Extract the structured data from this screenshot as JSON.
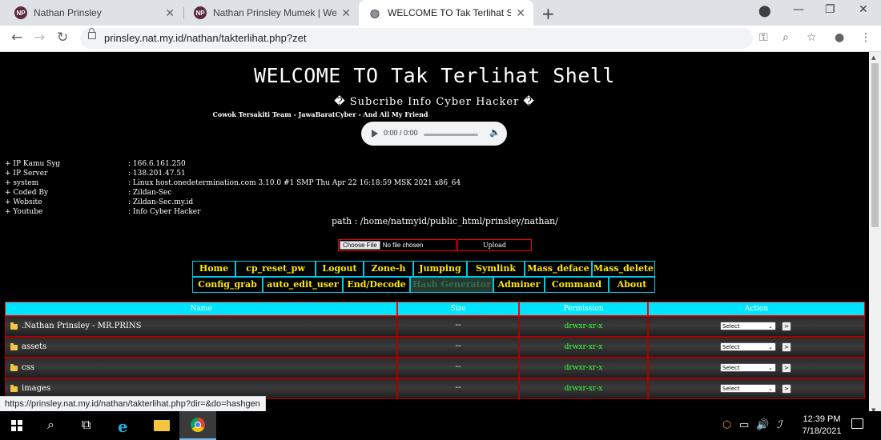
{
  "browser": {
    "tabs": [
      {
        "title": "Nathan Prinsley",
        "favicon": "NP",
        "active": false
      },
      {
        "title": "Nathan Prinsley Mumek | Website",
        "favicon": "NP",
        "active": false
      },
      {
        "title": "WELCOME TO Tak Terlihat Shell",
        "favicon": "globe",
        "active": true
      }
    ],
    "url": "prinsley.nat.my.id/nathan/takterlihat.php?zet",
    "status_url": "https://prinsley.nat.my.id/nathan/takterlihat.php?dir=&do=hashgen"
  },
  "page": {
    "title": "WELCOME TO Tak Terlihat Shell",
    "subtitle": "� Subcribe Info Cyber Hacker �",
    "credits": "Cowok Tersakiti Team - JawaBaratCyber - And All My Friend",
    "audio_time": "0:00 / 0:00",
    "info": [
      {
        "key": "+ IP Kamu Syg",
        "value": ": 166.6.161.250"
      },
      {
        "key": "+ IP Server",
        "value": ": 138.201.47.51"
      },
      {
        "key": "+ system",
        "value": ": Linux host.onedetermination.com 3.10.0 #1 SMP Thu Apr 22 16:18:59 MSK 2021 x86_64"
      },
      {
        "key": "+ Coded By",
        "value": ": Zildan-Sec"
      },
      {
        "key": "+ Website",
        "value": ": Zildan-Sec.my.id"
      },
      {
        "key": "+ Youtube",
        "value": ": Info Cyber Hacker"
      }
    ],
    "path": "path : /home/natmyid/public_html/prinsley/nathan/",
    "upload": {
      "choose_label": "Choose File",
      "no_file": "No file chosen",
      "button": "Upload"
    },
    "menu_row1": [
      "Home",
      "cp_reset_pw",
      "Logout",
      "Zone-h",
      "Jumping",
      "Symlink",
      "Mass_deface",
      "Mass_delete"
    ],
    "menu_row2": [
      "Config_grab",
      "auto_edit_user",
      "End/Decode",
      "Hash Generator",
      "Adminer",
      "Command",
      "About"
    ],
    "table": {
      "headers": [
        "Name",
        "Size",
        "Permission",
        "Action"
      ],
      "rows": [
        {
          "name": ".Nathan Prinsley - MR.PRINS",
          "size": "--",
          "perm": "drwxr-xr-x",
          "action": "Select",
          "go": ">"
        },
        {
          "name": "assets",
          "size": "--",
          "perm": "drwxr-xr-x",
          "action": "Select",
          "go": ">"
        },
        {
          "name": "css",
          "size": "--",
          "perm": "drwxr-xr-x",
          "action": "Select",
          "go": ">"
        },
        {
          "name": "images",
          "size": "--",
          "perm": "drwxr-xr-x",
          "action": "Select",
          "go": ">"
        }
      ]
    }
  },
  "taskbar": {
    "time": "12:39 PM",
    "date": "7/18/2021"
  }
}
